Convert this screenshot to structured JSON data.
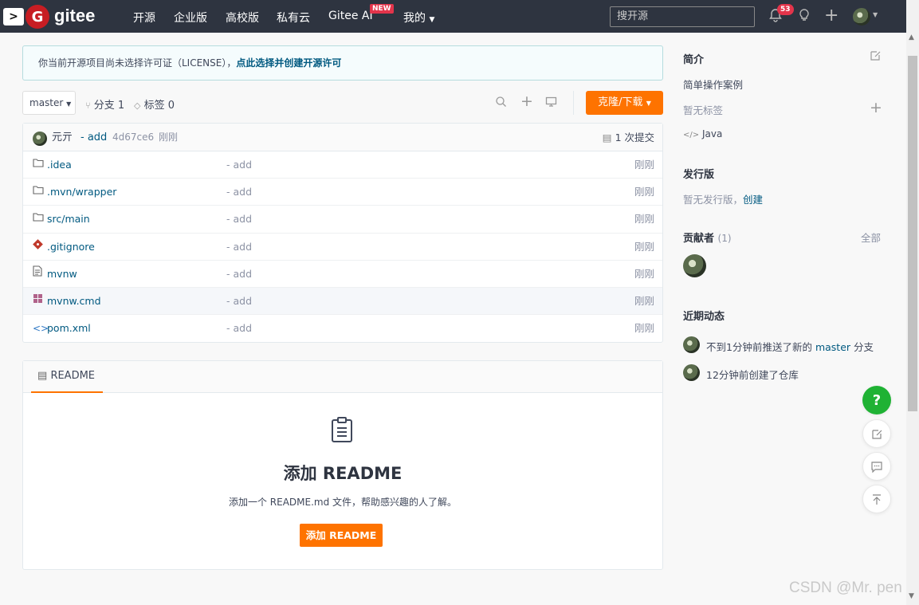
{
  "nav": {
    "terminal_glyph": ">",
    "logo_letter": "G",
    "brand": "gitee",
    "items": [
      "开源",
      "企业版",
      "高校版",
      "私有云",
      "Gitee AI",
      "我的"
    ],
    "new_badge": "NEW",
    "search_placeholder": "搜开源",
    "notification_count": "53"
  },
  "license_notice": {
    "text": "你当前开源项目尚未选择许可证（LICENSE），",
    "link": "点此选择并创建开源许可"
  },
  "repo_bar": {
    "branch": "master",
    "branches_label": "分支 1",
    "tags_label": "标签 0",
    "clone_label": "克隆/下载"
  },
  "commit": {
    "author": "元亓",
    "message": "- add",
    "hash": "4d67ce6",
    "time": "刚刚",
    "count_label": "1 次提交"
  },
  "files": [
    {
      "name": ".idea",
      "msg": "- add",
      "time": "刚刚",
      "icon": "folder-icon"
    },
    {
      "name": ".mvn/wrapper",
      "msg": "- add",
      "time": "刚刚",
      "icon": "folder-icon"
    },
    {
      "name": "src/main",
      "msg": "- add",
      "time": "刚刚",
      "icon": "folder-icon"
    },
    {
      "name": ".gitignore",
      "msg": "- add",
      "time": "刚刚",
      "icon": "git-icon"
    },
    {
      "name": "mvnw",
      "msg": "- add",
      "time": "刚刚",
      "icon": "file-icon"
    },
    {
      "name": "mvnw.cmd",
      "msg": "- add",
      "time": "刚刚",
      "icon": "windows-icon"
    },
    {
      "name": "pom.xml",
      "msg": "- add",
      "time": "刚刚",
      "icon": "code-icon"
    }
  ],
  "readme": {
    "tab": "README",
    "title": "添加 README",
    "subtitle": "添加一个 README.md 文件，帮助感兴趣的人了解。",
    "button": "添加 README"
  },
  "sidebar": {
    "intro_heading": "简介",
    "intro_text": "简单操作案例",
    "no_tags": "暂无标签",
    "language": "Java",
    "release_heading": "发行版",
    "no_release": "暂无发行版，",
    "create_link": "创建",
    "contributors_heading": "贡献者",
    "contributors_count": "(1)",
    "all_link": "全部",
    "activity_heading": "近期动态",
    "activity_1_prefix": "不到1分钟前推送了新的 ",
    "activity_1_branch": "master",
    "activity_1_suffix": " 分支",
    "activity_2": "12分钟前创建了仓库"
  },
  "float": {
    "help": "?"
  },
  "watermark": "CSDN @Mr. pen"
}
